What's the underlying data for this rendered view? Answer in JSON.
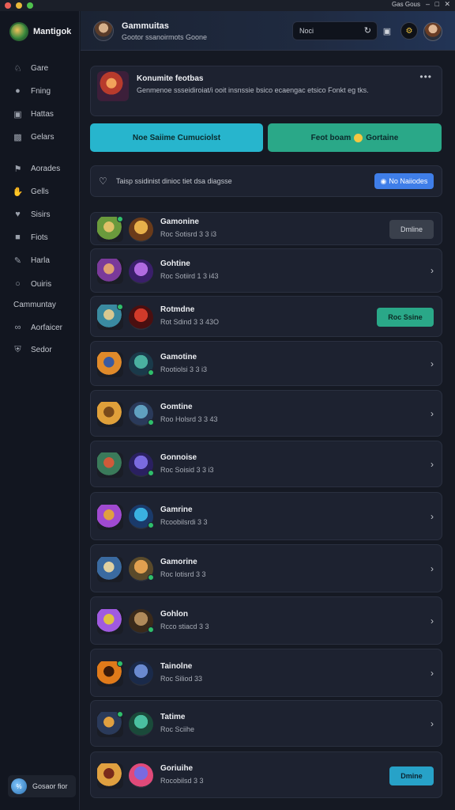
{
  "titlebar": {
    "right_text": "Gas Gous",
    "controls": [
      "–",
      "□",
      "✕"
    ]
  },
  "sidebar": {
    "brand": "Mantigok",
    "items": [
      {
        "label": "Gare",
        "icon": "character-icon"
      },
      {
        "label": "Fning",
        "icon": "pin-icon"
      },
      {
        "label": "Hattas",
        "icon": "folder-icon"
      },
      {
        "label": "Gelars",
        "icon": "card-icon"
      },
      {
        "label": "Aorades",
        "icon": "flag-icon"
      },
      {
        "label": "Gells",
        "icon": "hand-icon"
      },
      {
        "label": "Sisirs",
        "icon": "heart-icon"
      },
      {
        "label": "Fiots",
        "icon": "box-icon"
      },
      {
        "label": "Harla",
        "icon": "pen-icon"
      },
      {
        "label": "Ouiris",
        "icon": "circle-icon"
      }
    ],
    "section_label": "Cammuntay",
    "extra_items": [
      {
        "label": "Aorfaicer",
        "icon": "glasses-icon"
      },
      {
        "label": "Sedor",
        "icon": "shield-icon"
      }
    ],
    "user_chip": {
      "initials": "% ",
      "label": "Gosaor fior"
    }
  },
  "topbar": {
    "title": "Gammuitas",
    "subtitle": "Gootor ssanoirmots Goone",
    "search_value": "Noci",
    "search_icon": "refresh-icon",
    "icons": [
      "folder-icon",
      "coin-icon"
    ],
    "coin_symbol": "⚙"
  },
  "featured": {
    "title": "Konumite feotbas",
    "description": "Genmenoe ssseidiroiat/i ooit insnssie bsico ecaengac etsico Fonkt eg tks.",
    "more": "•••"
  },
  "actions": {
    "primary": "Noe Saiime Cumuciolst",
    "secondary_before": "Feot boam",
    "secondary_after": "Gortaine"
  },
  "notice": {
    "text": "Taisp ssidinist dinioc tiet dsa diagsse",
    "button": "No Naiiodes",
    "button_icon": "globe-icon"
  },
  "rows": [
    {
      "name": "Gamonine",
      "sub": "Roc Sotisrd 3 3 i3",
      "action": "pill-gray",
      "action_label": "Dmline",
      "av1": [
        "#6a9a3c",
        "#e0c068"
      ],
      "av2": [
        "#e7b04a",
        "#6a3b1a"
      ],
      "dot1": true,
      "dot2": false
    },
    {
      "name": "Gohtine",
      "sub": "Roc Sotiird 1 3 i43",
      "action": "chevron",
      "action_label": "›",
      "av1": [
        "#7a3a9a",
        "#e0a070"
      ],
      "av2": [
        "#b06ae0",
        "#3a1f6a"
      ],
      "dot1": false,
      "dot2": false
    },
    {
      "name": "Rotmdne",
      "sub": "Rot Sdind 3 3 43O",
      "action": "pill-green",
      "action_label": "Roc Ssine",
      "av1": [
        "#3a8aa0",
        "#d8c890"
      ],
      "av2": [
        "#d03a2a",
        "#4a0f10"
      ],
      "dot1": true,
      "dot2": false
    },
    {
      "name": "Gamotine",
      "sub": "Rootiolsi 3 3 i3",
      "action": "chevron",
      "action_label": "›",
      "av1": [
        "#e08a2a",
        "#3a5aa0"
      ],
      "av2": [
        "#4ab0a0",
        "#1a3a4a"
      ],
      "dot1": false,
      "dot2": true
    },
    {
      "name": "Gomtine",
      "sub": "Roo Holsrd 3 3 43",
      "action": "chevron",
      "action_label": "›",
      "av1": [
        "#e0a03a",
        "#7a4a1a"
      ],
      "av2": [
        "#60a0c0",
        "#2a3a5a"
      ],
      "dot1": false,
      "dot2": true
    },
    {
      "name": "Gonnoise",
      "sub": "Roc Soisid 3 3 i3",
      "action": "chevron",
      "action_label": "›",
      "av1": [
        "#3a7a5a",
        "#d05a3a"
      ],
      "av2": [
        "#7a6ae0",
        "#2a2060"
      ],
      "dot1": false,
      "dot2": true
    },
    {
      "name": "Gamrine",
      "sub": "Rcoobilsrdi 3 3",
      "action": "chevron",
      "action_label": "›",
      "av1": [
        "#a04ad0",
        "#e0a040"
      ],
      "av2": [
        "#3ab0e0",
        "#1a3a6a"
      ],
      "dot1": false,
      "dot2": true
    },
    {
      "name": "Gamorine",
      "sub": "Roc lotisrd 3 3",
      "action": "chevron",
      "action_label": "›",
      "av1": [
        "#3a6aa0",
        "#e0d0a0"
      ],
      "av2": [
        "#e0a050",
        "#5a4a2a"
      ],
      "dot1": false,
      "dot2": true
    },
    {
      "name": "Gohlon",
      "sub": "Rcco stiacd 3 3",
      "action": "chevron",
      "action_label": "›",
      "av1": [
        "#a05ae0",
        "#e0c040"
      ],
      "av2": [
        "#b08a5a",
        "#3a2a1a"
      ],
      "dot1": false,
      "dot2": true
    },
    {
      "name": "Tainolne",
      "sub": "Roc Siliod 33",
      "action": "chevron",
      "action_label": "›",
      "av1": [
        "#e07a1a",
        "#3a1a0a"
      ],
      "av2": [
        "#6a8ad0",
        "#1a2a4a"
      ],
      "dot1": true,
      "dot2": false
    },
    {
      "name": "Tatime",
      "sub": "Roc Sciihe",
      "action": "chevron",
      "action_label": "›",
      "av1": [
        "#2a3a5a",
        "#e0a040"
      ],
      "av2": [
        "#4ac0a0",
        "#1a4a3a"
      ],
      "dot1": true,
      "dot2": false
    },
    {
      "name": "Goriuihe",
      "sub": "Rocobilsd 3 3",
      "action": "pill-blue",
      "action_label": "Dmine",
      "av1": [
        "#e0a040",
        "#7a2a1a"
      ],
      "av2": [
        "#7a6ae0",
        "#e04a7a"
      ],
      "dot1": false,
      "dot2": false
    }
  ]
}
